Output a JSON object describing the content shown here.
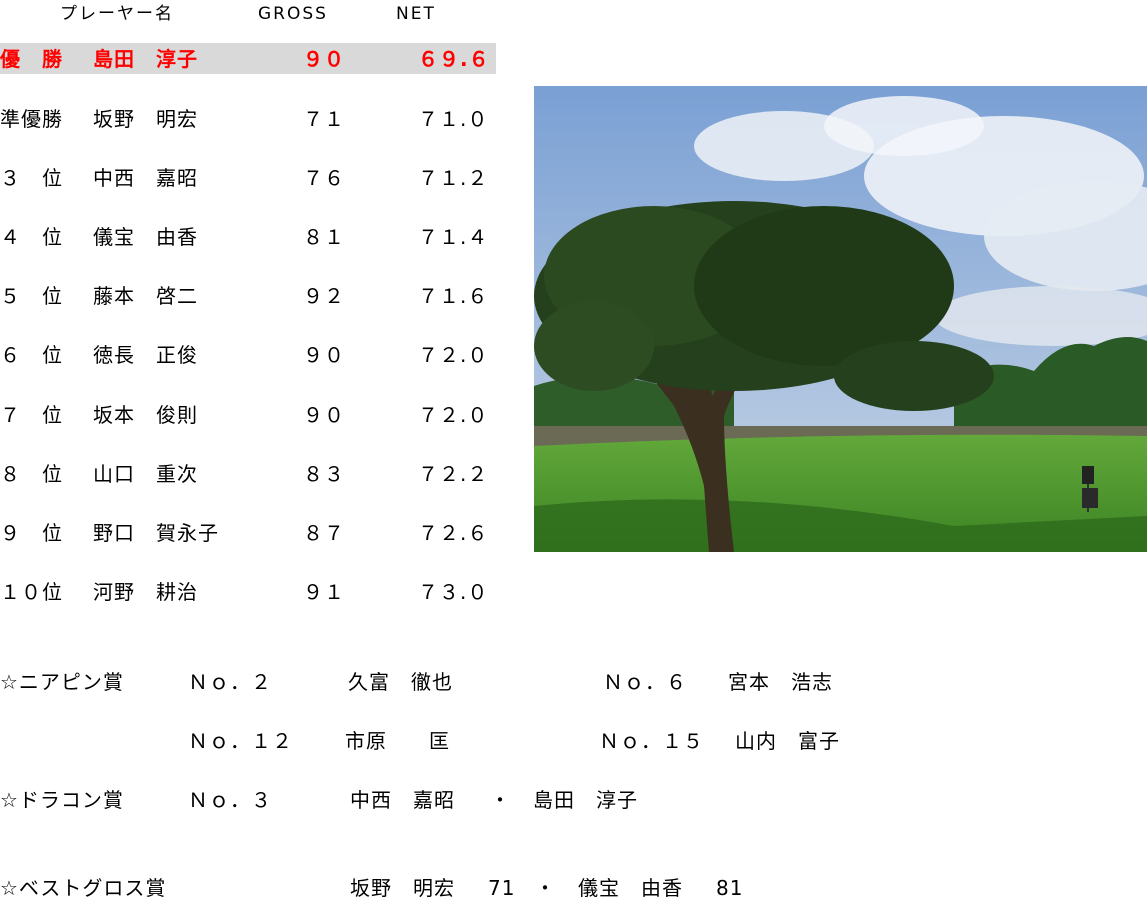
{
  "header": {
    "player_label": "プレーヤー名",
    "gross_label": "GROSS",
    "net_label": "NET"
  },
  "rankings": [
    {
      "rank": "優　勝",
      "name": "島田　淳子",
      "gross": "９０",
      "net": "６９.６",
      "highlight": true
    },
    {
      "rank": "準優勝",
      "name": "坂野　明宏",
      "gross": "７１",
      "net": "７１.０"
    },
    {
      "rank": "３　位",
      "name": "中西　嘉昭",
      "gross": "７６",
      "net": "７１.２"
    },
    {
      "rank": "４　位",
      "name": "儀宝　由香",
      "gross": "８１",
      "net": "７１.４"
    },
    {
      "rank": "５　位",
      "name": "藤本　啓二",
      "gross": "９２",
      "net": "７１.６"
    },
    {
      "rank": "６　位",
      "name": "徳長　正俊",
      "gross": "９０",
      "net": "７２.０"
    },
    {
      "rank": "７　位",
      "name": "坂本　俊則",
      "gross": "９０",
      "net": "７２.０"
    },
    {
      "rank": "８　位",
      "name": "山口　重次",
      "gross": "８３",
      "net": "７２.２"
    },
    {
      "rank": "９　位",
      "name": "野口　賀永子",
      "gross": "８７",
      "net": "７２.６"
    },
    {
      "rank": "１０位",
      "name": "河野　耕治",
      "gross": "９１",
      "net": "７３.０"
    }
  ],
  "awards": {
    "nearpin": {
      "label": "☆ニアピン賞",
      "entries": [
        {
          "hole": "Ｎｏ．２",
          "winner": "久富　徹也"
        },
        {
          "hole": "Ｎｏ．６",
          "winner": "宮本　浩志"
        },
        {
          "hole": "Ｎｏ．１２",
          "winner": "市原　　匡"
        },
        {
          "hole": "Ｎｏ．１５",
          "winner": "山内　富子"
        }
      ]
    },
    "dracon": {
      "label": "☆ドラコン賞",
      "hole": "Ｎｏ．３",
      "winner1": "中西　嘉昭",
      "separator": "・",
      "winner2": "島田　淳子"
    },
    "bestgross": {
      "label": "☆ベストグロス賞",
      "winner1": "坂野　明宏",
      "score1": "71",
      "separator": "・",
      "winner2": "儀宝　由香",
      "score2": "81"
    }
  },
  "photo": {
    "subject": "golf-course-tree-photo",
    "sky_color": "#86a8d6",
    "grass_color": "#3f8a2a"
  }
}
